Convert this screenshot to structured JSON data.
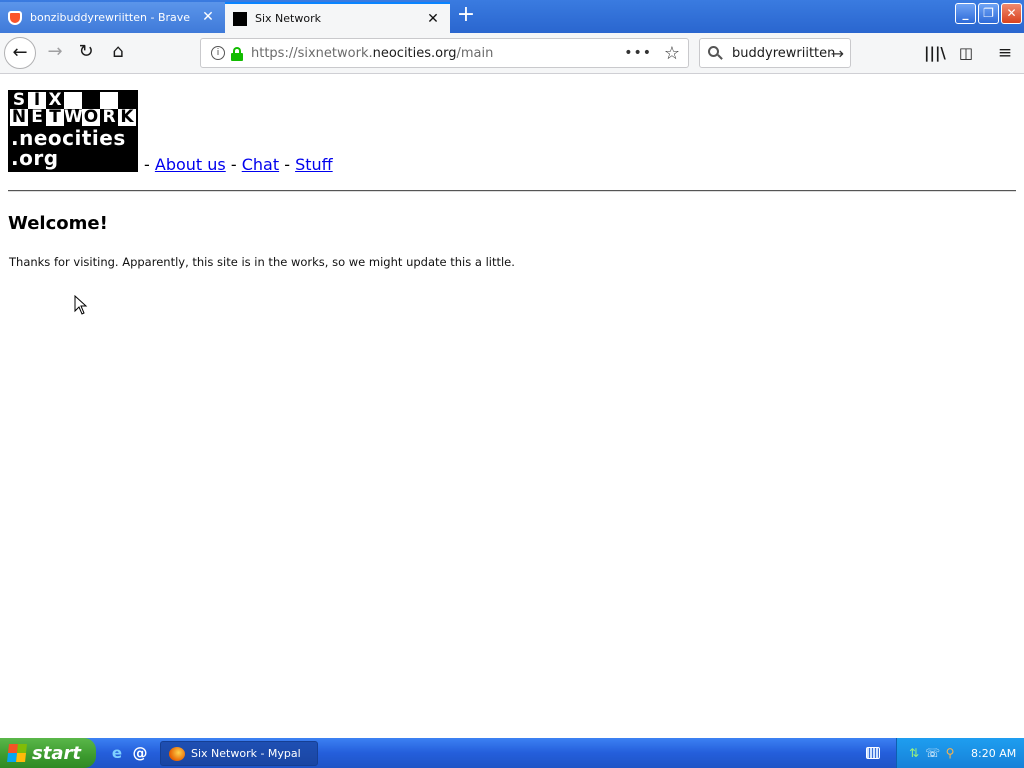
{
  "browser": {
    "tabs": [
      {
        "title": "bonzibuddyrewriitten - Brave Sear",
        "active": false,
        "favicon": "brave-icon"
      },
      {
        "title": "Six Network",
        "active": true,
        "favicon": "six-network-favicon"
      }
    ],
    "new_tab_label": "+",
    "url": {
      "prefix": "https://sixnetwork.",
      "host": "neocities.org",
      "path": "/main"
    },
    "search_value": "buddyrewriitten"
  },
  "page": {
    "logo": {
      "row1": [
        "S",
        "I",
        "X",
        "",
        "",
        "",
        ""
      ],
      "row2": [
        "N",
        "E",
        "T",
        "W",
        "O",
        "R",
        "K"
      ],
      "line1": ".neocities",
      "line2": ".org"
    },
    "nav": {
      "sep1": "-",
      "about": "About us",
      "sep2": "-",
      "chat": "Chat",
      "sep3": "-",
      "stuff": "Stuff"
    },
    "heading": "Welcome!",
    "intro": "Thanks for visiting. Apparently, this site is in the works, so we might update this a little."
  },
  "taskbar": {
    "start_label": "start",
    "task_title": "Six Network - Mypal",
    "clock": "8:20 AM"
  },
  "colors": {
    "link": "#0000ee",
    "lock_green": "#12bc00",
    "taskbar_blue": "#245edb",
    "start_green": "#3c9a2e"
  }
}
